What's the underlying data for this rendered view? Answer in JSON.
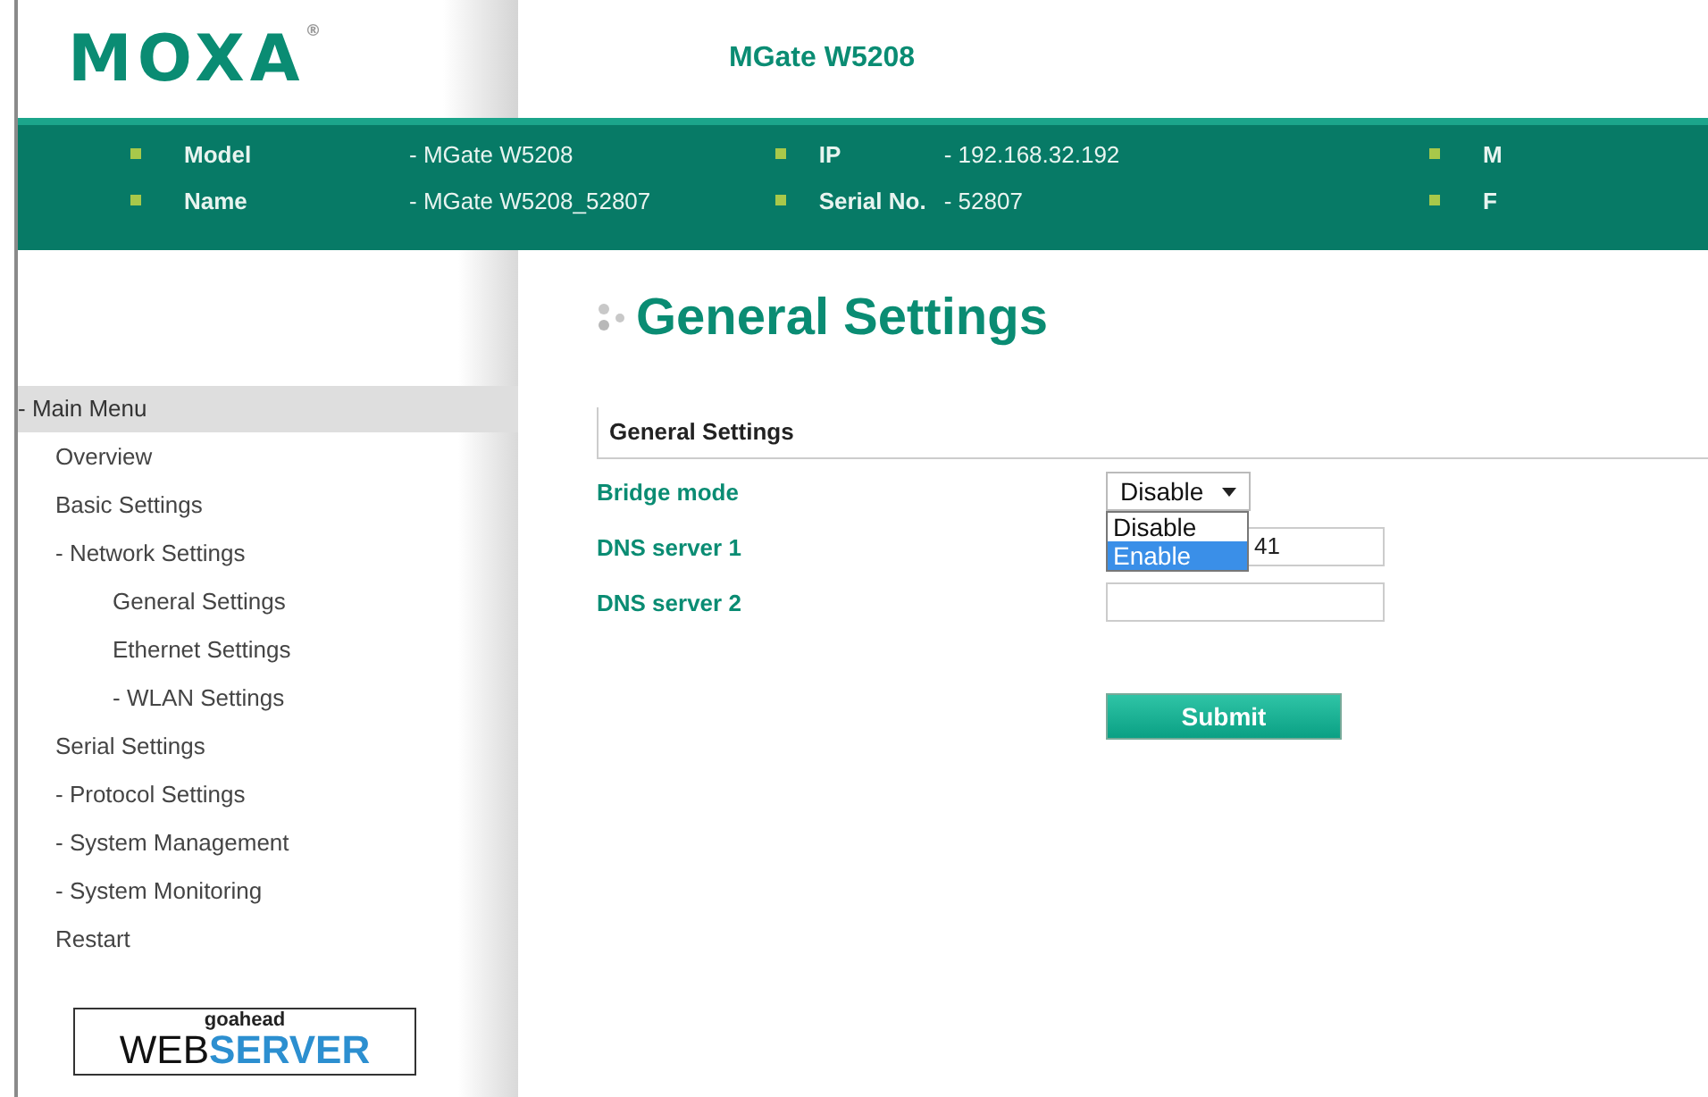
{
  "header": {
    "logo": "MOXA",
    "registered": "®",
    "product": "MGate W5208"
  },
  "info_bar": {
    "columns": [
      {
        "items": [
          {
            "label": "Model",
            "value": "- MGate W5208"
          },
          {
            "label": "Name",
            "value": "- MGate W5208_52807"
          }
        ]
      },
      {
        "items": [
          {
            "label": "IP",
            "value": "- 192.168.32.192"
          },
          {
            "label": "Serial No.",
            "value": "- 52807"
          }
        ]
      },
      {
        "items": [
          {
            "label": "M"
          },
          {
            "label": "F"
          }
        ]
      }
    ]
  },
  "sidebar": {
    "title": "- Main Menu",
    "items": [
      {
        "label": "Overview"
      },
      {
        "label": "Basic Settings"
      },
      {
        "label": "- Network Settings",
        "children": [
          {
            "label": "General Settings"
          },
          {
            "label": "Ethernet Settings"
          },
          {
            "label": "- WLAN Settings"
          }
        ]
      },
      {
        "label": "Serial Settings"
      },
      {
        "label": "- Protocol Settings"
      },
      {
        "label": "- System Management"
      },
      {
        "label": "- System Monitoring"
      },
      {
        "label": "Restart"
      }
    ],
    "badge": {
      "top": "goahead",
      "left": "WEB",
      "right": "SERVER"
    }
  },
  "page": {
    "title": "General Settings",
    "section": "General Settings",
    "fields": [
      {
        "kind": "select",
        "label": "Bridge mode",
        "value": "Disable",
        "expanded": true,
        "options": [
          {
            "label": "Disable",
            "highlighted": false
          },
          {
            "label": "Enable",
            "highlighted": true
          }
        ]
      },
      {
        "kind": "text",
        "label": "DNS server 1",
        "value": "41"
      },
      {
        "kind": "text",
        "label": "DNS server 2"
      }
    ],
    "submit": "Submit"
  }
}
